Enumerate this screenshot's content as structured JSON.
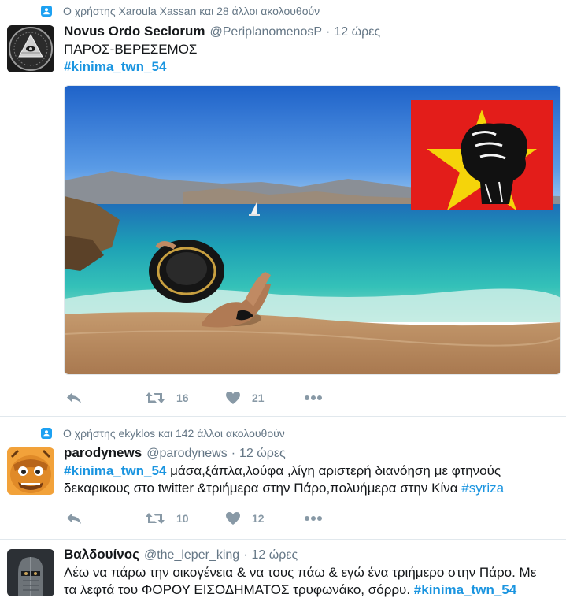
{
  "tweets": [
    {
      "context": "Ο χρήστης Xaroula Xassan και 28 άλλοι ακολουθούν",
      "name": "Novus Ordo Seclorum",
      "handle": "@PeriplanomenosP",
      "time": "12 ώρες",
      "text_lines": [
        "ΠΑΡΟΣ-ΒΕΡΕΣΕΜΟΣ"
      ],
      "hashtag": "#kinima_twn_54",
      "avatar_icon": "eye-pyramid-icon",
      "retweets": "16",
      "likes": "21"
    },
    {
      "context": "Ο χρήστης ekyklos και 142 άλλοι ακολουθούν",
      "name": "parodynews",
      "handle": "@parodynews",
      "time": "12 ώρες",
      "hashtag": "#kinima_twn_54",
      "text_part1": " μάσα,ξάπλα,λούφα ,λίγη αριστερή διανόηση με φτηνούς",
      "text_line2": "δεκαρικους στο twitter &τριήμερα στην Πάρο,πολυήμερα στην Κίνα ",
      "hashtag2": "#syriza",
      "avatar_icon": "cartoon-face-icon",
      "retweets": "10",
      "likes": "12"
    },
    {
      "name": "Βαλδουίνος",
      "handle": "@the_leper_king",
      "time": "12 ώρες",
      "text_line1": "Λέω να πάρω την οικογένεια & να τους πάω & εγώ ένα τριήμερο στην Πάρο. Με",
      "text_line2": "τα λεφτά του ΦΟΡΟΥ ΕΙΣΟΔΗΜΑΤΟΣ τρυφωνάκο, σόρρυ. ",
      "hashtag": "#kinima_twn_54",
      "avatar_icon": "knight-helmet-icon"
    }
  ],
  "separator": "·",
  "colors": {
    "accent": "#1b95e0",
    "secondary_text": "#657786",
    "action_icon": "#8899a6"
  }
}
